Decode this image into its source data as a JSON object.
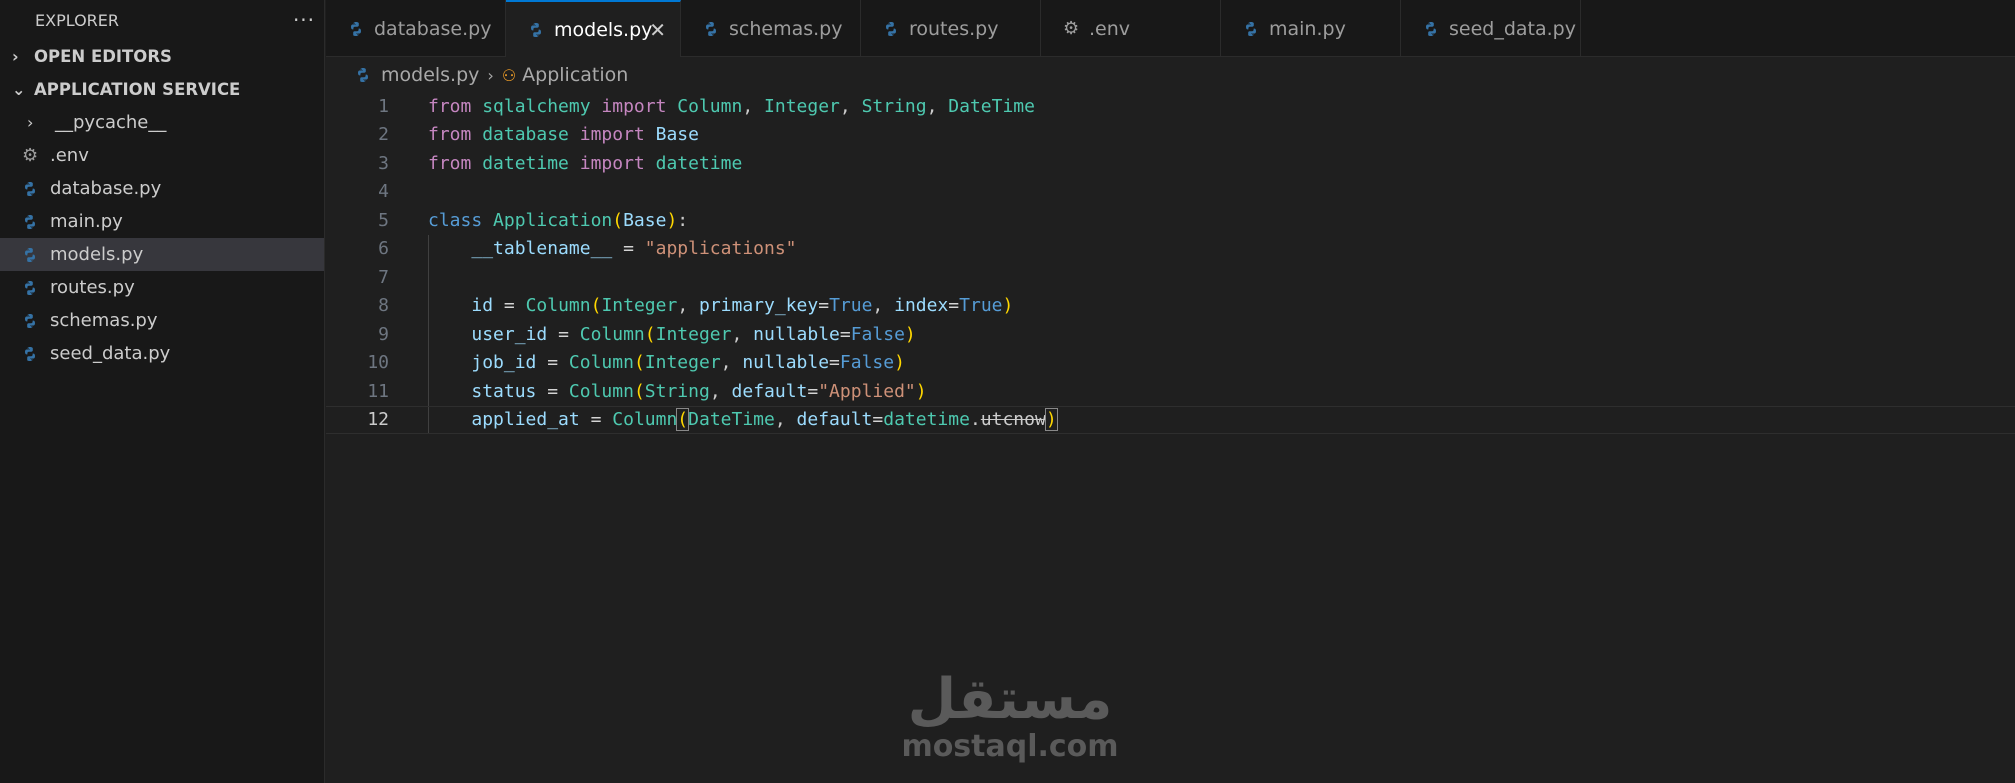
{
  "sidebar": {
    "title": "EXPLORER",
    "more": "···",
    "open_editors": "OPEN EDITORS",
    "project": "APPLICATION SERVICE",
    "items": [
      {
        "label": "__pycache__",
        "type": "folder"
      },
      {
        "label": ".env",
        "type": "env"
      },
      {
        "label": "database.py",
        "type": "py"
      },
      {
        "label": "main.py",
        "type": "py"
      },
      {
        "label": "models.py",
        "type": "py",
        "selected": true
      },
      {
        "label": "routes.py",
        "type": "py"
      },
      {
        "label": "schemas.py",
        "type": "py"
      },
      {
        "label": "seed_data.py",
        "type": "py"
      }
    ]
  },
  "tabs": [
    {
      "label": "database.py"
    },
    {
      "label": "models.py",
      "active": true
    },
    {
      "label": "schemas.py"
    },
    {
      "label": "routes.py"
    },
    {
      "label": ".env"
    },
    {
      "label": "main.py"
    },
    {
      "label": "seed_data.py"
    }
  ],
  "breadcrumb": {
    "file": "models.py",
    "symbol": "Application"
  },
  "editor": {
    "current_line": 12,
    "line_numbers": [
      "1",
      "2",
      "3",
      "4",
      "5",
      "6",
      "7",
      "8",
      "9",
      "10",
      "11",
      "12"
    ]
  },
  "colors": {
    "accent": "#0078d4",
    "python_blue": "#3572a5",
    "python_yellow": "#ffd43b"
  },
  "watermark": {
    "arabic": "مستقل",
    "latin": "mostaql.com"
  }
}
